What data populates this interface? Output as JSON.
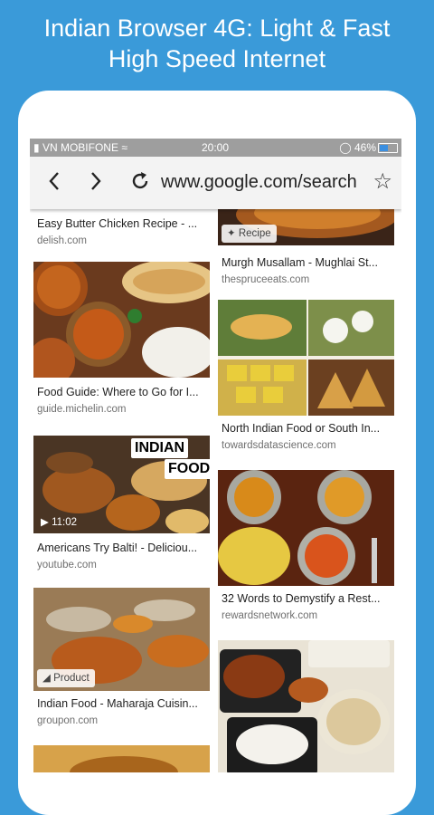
{
  "promo": {
    "line1": "Indian Browser 4G: Light & Fast",
    "line2": "High Speed Internet"
  },
  "status": {
    "carrier": "VN MOBIFONE",
    "time": "20:00",
    "battery": "46%"
  },
  "browser": {
    "url": "www.google.com/search",
    "back_icon": "chevron-left-icon",
    "forward_icon": "chevron-right-icon",
    "reload_icon": "reload-icon",
    "bookmark_icon": "star-icon"
  },
  "results": {
    "left": [
      {
        "caption": "Easy Butter Chicken Recipe - ...",
        "source": "delish.com"
      },
      {
        "caption": "Food Guide: Where to Go for I...",
        "source": "guide.michelin.com"
      },
      {
        "caption": "Americans Try Balti! - Deliciou...",
        "source": "youtube.com",
        "duration": "11:02",
        "overlay1": "INDIAN",
        "overlay2": "FOOD!"
      },
      {
        "caption": "Indian Food - Maharaja Cuisin...",
        "source": "groupon.com",
        "badge": "Product"
      }
    ],
    "right": [
      {
        "caption": "Murgh Musallam - Mughlai St...",
        "source": "thespruceeats.com",
        "badge": "Recipe"
      },
      {
        "caption": "North Indian Food or South In...",
        "source": "towardsdatascience.com"
      },
      {
        "caption": "32 Words to Demystify a Rest...",
        "source": "rewardsnetwork.com"
      }
    ]
  },
  "colors": {
    "background": "#3a9ad9",
    "statusbar": "#9e9e9e",
    "urlbar": "#f3f3f3"
  }
}
